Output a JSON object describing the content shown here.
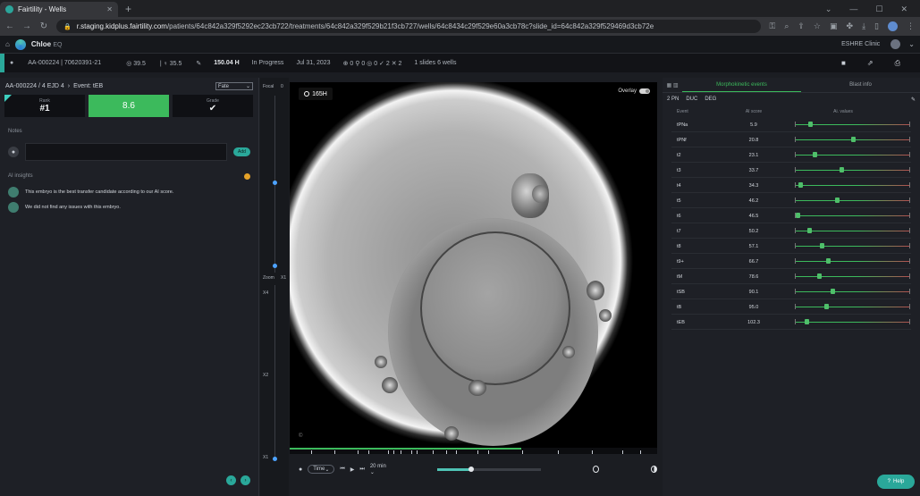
{
  "browser": {
    "tab_title": "Fairtility - Wells",
    "url_host": "r.staging.kidplus.fairtility.com",
    "url_path": "/patients/64c842a329f5292ec23cb722/treatments/64c842a329f529b21f3cb727/wells/64c8434c29f529e60a3cb78c?slide_id=64c842a329f529469d3cb72e"
  },
  "app": {
    "name": "Chloe",
    "name_suffix": "EQ",
    "clinic": "ESHRE Clinic"
  },
  "patient_bar": {
    "patient_id": "AA-000224 | 70620391-21",
    "age": "39.5",
    "bmi": "35.5",
    "coverage": "150.04 H",
    "status": "In Progress",
    "date": "Jul 31, 2023",
    "counts": "⊕ 0  ⚲ 0  ◎ 0  ✓ 2  ✕ 2",
    "slides": "1 slides  6 wells"
  },
  "left_panel": {
    "embryo_id": "AA-000224 / 4 EJD 4",
    "event_label": "Event: tEB",
    "select_value": "Fate",
    "rank_label": "Rank",
    "rank_value": "#1",
    "score_label": "KIDScore",
    "score_value": "8.6",
    "grade_label": "Grade",
    "notes_label": "Notes",
    "add_label": "Add",
    "ai_label": "AI insights",
    "insights": [
      "This embryo is the best transfer candidate according to our AI score.",
      "We did not find any issues with this embryo."
    ]
  },
  "focal": {
    "focal_label": "Focal",
    "focal_value": "0",
    "zoom_label": "Zoom",
    "zoom_value": "X1",
    "zoom_levels": [
      "X4",
      "X2",
      "X1"
    ]
  },
  "viewer": {
    "time_badge": "165H",
    "overlay_label": "Overlay",
    "timeline_progress": 0.63
  },
  "controls": {
    "mode_label": "Time",
    "interval_label": "20 min"
  },
  "right_panel": {
    "tab_active": "Morphokinetic events",
    "tab_inactive": "Blast info",
    "pn_options": [
      "2 PN",
      "DUC",
      "DEG"
    ],
    "col_event": "Event",
    "col_score": "AI score",
    "col_range": "Ai. values",
    "events": [
      {
        "name": "tPNa",
        "score": "5.9",
        "pos": 0.12
      },
      {
        "name": "tPNf",
        "score": "20.8",
        "pos": 0.5
      },
      {
        "name": "t2",
        "score": "23.1",
        "pos": 0.16
      },
      {
        "name": "t3",
        "score": "33.7",
        "pos": 0.4
      },
      {
        "name": "t4",
        "score": "34.3",
        "pos": 0.03
      },
      {
        "name": "t5",
        "score": "46.2",
        "pos": 0.36
      },
      {
        "name": "t6",
        "score": "46.5",
        "pos": 0.01
      },
      {
        "name": "t7",
        "score": "50.2",
        "pos": 0.11
      },
      {
        "name": "t8",
        "score": "57.1",
        "pos": 0.22
      },
      {
        "name": "t9+",
        "score": "66.7",
        "pos": 0.28
      },
      {
        "name": "tM",
        "score": "78.6",
        "pos": 0.2
      },
      {
        "name": "tSB",
        "score": "90.1",
        "pos": 0.32
      },
      {
        "name": "tB",
        "score": "95.0",
        "pos": 0.26
      },
      {
        "name": "tEB",
        "score": "102.3",
        "pos": 0.09
      }
    ]
  },
  "help_label": "Help"
}
